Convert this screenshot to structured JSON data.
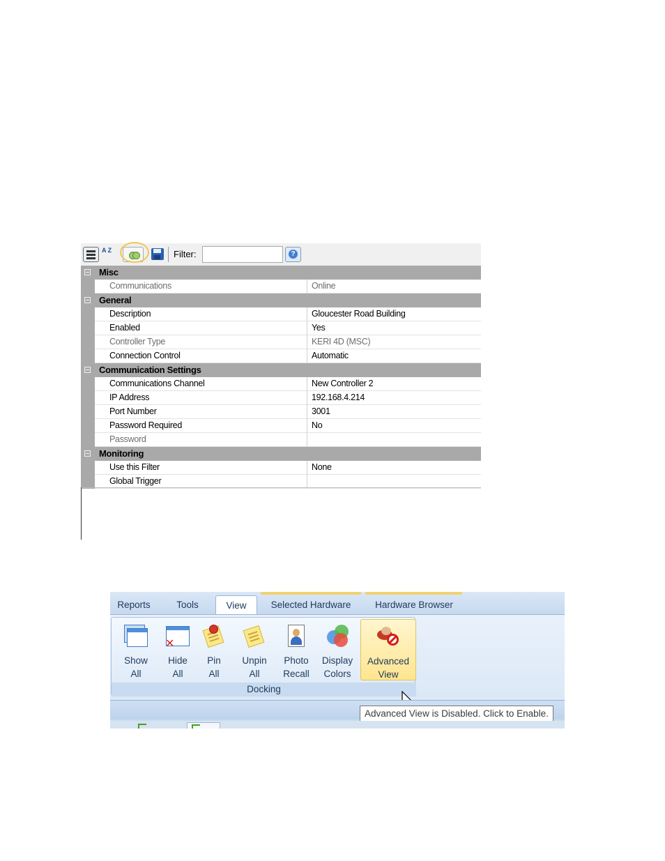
{
  "property_grid": {
    "toolbar": {
      "categorized_icon": "categorized-icon",
      "alphabetical_icon": "sort-az-icon",
      "alphabetical_glyph": "A Z",
      "toggle_icon": "advanced-toggle-icon",
      "save_icon": "save-icon",
      "filter_label": "Filter:",
      "filter_value": "",
      "help_icon": "help-icon",
      "help_glyph": "?",
      "highlight_color": "#f0c94e"
    },
    "categories": [
      {
        "label": "Misc",
        "rows": [
          {
            "name": "Communications",
            "value": "Online",
            "readonly": true
          }
        ]
      },
      {
        "label": "General",
        "rows": [
          {
            "name": "Description",
            "value": "Gloucester Road Building",
            "readonly": false
          },
          {
            "name": "Enabled",
            "value": "Yes",
            "readonly": false
          },
          {
            "name": "Controller Type",
            "value": "KERI 4D (MSC)",
            "readonly": true
          },
          {
            "name": "Connection Control",
            "value": "Automatic",
            "readonly": false
          }
        ]
      },
      {
        "label": "Communication Settings",
        "rows": [
          {
            "name": "Communications Channel",
            "value": "New Controller 2",
            "readonly": false
          },
          {
            "name": "IP Address",
            "value": "192.168.4.214",
            "readonly": false
          },
          {
            "name": "Port Number",
            "value": "3001",
            "readonly": false
          },
          {
            "name": "Password Required",
            "value": "No",
            "readonly": false
          },
          {
            "name": "Password",
            "value": "",
            "readonly": true
          }
        ]
      },
      {
        "label": "Monitoring",
        "rows": [
          {
            "name": "Use this Filter",
            "value": "None",
            "readonly": false
          },
          {
            "name": "Global Trigger",
            "value": "",
            "readonly": false
          }
        ]
      }
    ]
  },
  "ribbon": {
    "tabs": [
      {
        "label": "Reports",
        "active": false
      },
      {
        "label": "Tools",
        "active": false
      },
      {
        "label": "View",
        "active": true
      },
      {
        "label": "Selected Hardware",
        "active": false
      },
      {
        "label": "Hardware Browser",
        "active": false
      }
    ],
    "contextual_color": "#f1d270",
    "group_label": "Docking",
    "buttons": [
      {
        "line1": "Show",
        "line2": "All",
        "icon": "show-all-icon"
      },
      {
        "line1": "Hide",
        "line2": "All",
        "icon": "hide-all-icon"
      },
      {
        "line1": "Pin",
        "line2": "All",
        "icon": "pin-all-icon"
      },
      {
        "line1": "Unpin",
        "line2": "All",
        "icon": "unpin-all-icon"
      },
      {
        "line1": "Photo",
        "line2": "Recall",
        "icon": "photo-recall-icon"
      },
      {
        "line1": "Display",
        "line2": "Colors",
        "icon": "display-colors-icon"
      },
      {
        "line1": "Advanced",
        "line2": "View",
        "icon": "advanced-view-disabled-icon",
        "highlighted": true
      }
    ],
    "tooltip": "Advanced View is Disabled. Click to Enable."
  }
}
